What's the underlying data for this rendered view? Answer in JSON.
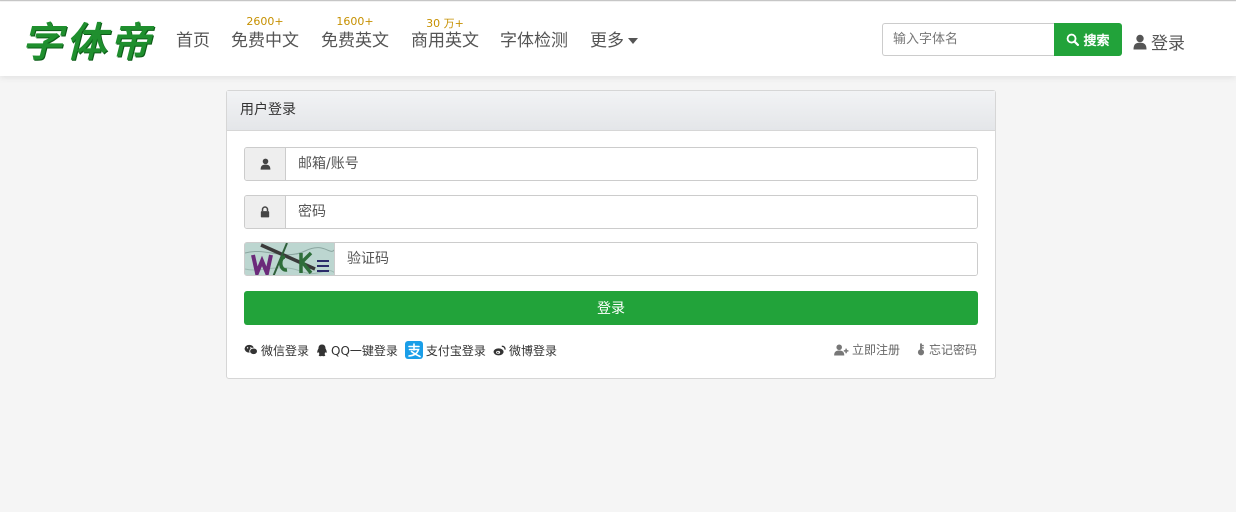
{
  "brand": {
    "logo_text": "字体帝",
    "logo_color": "#1f8f2e"
  },
  "nav": {
    "items": [
      {
        "label": "首页",
        "badge": ""
      },
      {
        "label": "免费中文",
        "badge": "2600+"
      },
      {
        "label": "免费英文",
        "badge": "1600+"
      },
      {
        "label": "商用英文",
        "badge": "30 万+"
      },
      {
        "label": "字体检测",
        "badge": ""
      },
      {
        "label": "更多",
        "badge": ""
      }
    ]
  },
  "search": {
    "placeholder": "输入字体名",
    "button_label": "搜索"
  },
  "header": {
    "login_label": "登录"
  },
  "login_panel": {
    "title": "用户登录",
    "account_placeholder": "邮箱/账号",
    "password_placeholder": "密码",
    "captcha_placeholder": "验证码",
    "submit_label": "登录",
    "social": {
      "wechat": "微信登录",
      "qq": "QQ一键登录",
      "alipay": "支付宝登录",
      "weibo": "微博登录"
    },
    "register_label": "立即注册",
    "forgot_label": "忘记密码"
  },
  "colors": {
    "accent": "#22a33a",
    "badge": "#c69000",
    "alipay": "#1a9ee8"
  },
  "icons": [
    "search-icon",
    "user-icon",
    "lock-icon",
    "wechat-icon",
    "qq-icon",
    "alipay-icon",
    "weibo-icon",
    "add-user-icon",
    "key-icon",
    "chevron-down-icon"
  ]
}
